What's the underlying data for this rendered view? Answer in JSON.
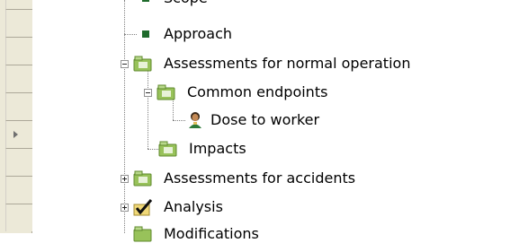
{
  "tree": {
    "items": [
      {
        "label": "Scope",
        "icon": "green-square-icon"
      },
      {
        "label": "Approach",
        "icon": "green-square-icon"
      },
      {
        "label": "Assessments for normal operation",
        "icon": "folder-icon",
        "state": "expanded"
      },
      {
        "label": "Common endpoints",
        "icon": "folder-icon",
        "state": "expanded"
      },
      {
        "label": "Dose to worker",
        "icon": "person-icon"
      },
      {
        "label": "Impacts",
        "icon": "folder-icon"
      },
      {
        "label": "Assessments for accidents",
        "icon": "folder-icon",
        "state": "collapsed"
      },
      {
        "label": "Analysis",
        "icon": "checked-folder-icon",
        "state": "collapsed"
      },
      {
        "label": "Modifications",
        "icon": "folder-icon"
      }
    ]
  },
  "colors": {
    "gutter": "#ece9d8",
    "square": "#1f6b2c",
    "folder": "#98c25a",
    "checkmark": "#111111"
  }
}
